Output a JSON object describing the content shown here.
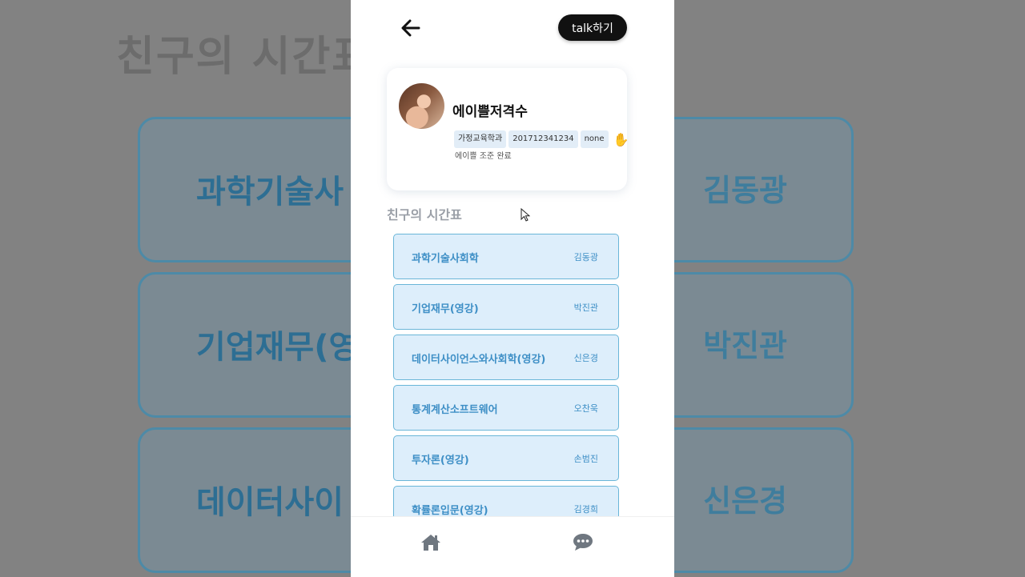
{
  "background": {
    "title": "친구의 시간표",
    "rows": [
      {
        "left": "과학기술사",
        "right": "김동광"
      },
      {
        "left": "기업재무(영",
        "right": "박진관"
      },
      {
        "left": "데이터사이",
        "right": "신은경"
      }
    ]
  },
  "header": {
    "back_icon": "arrow-left-icon",
    "talk_label": "talk하기"
  },
  "profile": {
    "name": "에이쁠저격수",
    "tags": [
      "가정교육학과",
      "201712341234",
      "none"
    ],
    "hand_glyph": "✋",
    "status": "에이쁠 조준 완료"
  },
  "timetable": {
    "title": "친구의 시간표",
    "courses": [
      {
        "name": "과학기술사회학",
        "professor": "김동광"
      },
      {
        "name": "기업재무(영강)",
        "professor": "박진관"
      },
      {
        "name": "데이터사이언스와사회학(영강)",
        "professor": "신은경"
      },
      {
        "name": "통계계산소프트웨어",
        "professor": "오찬욱"
      },
      {
        "name": "투자론(영강)",
        "professor": "손범진"
      },
      {
        "name": "확률론입문(영강)",
        "professor": "김경희"
      }
    ]
  },
  "nav": {
    "home_icon": "home-icon",
    "chat_icon": "chat-icon"
  },
  "colors": {
    "accent": "#3e8fc6",
    "card_bg": "#ddeefb",
    "card_border": "#6ab6d8"
  }
}
